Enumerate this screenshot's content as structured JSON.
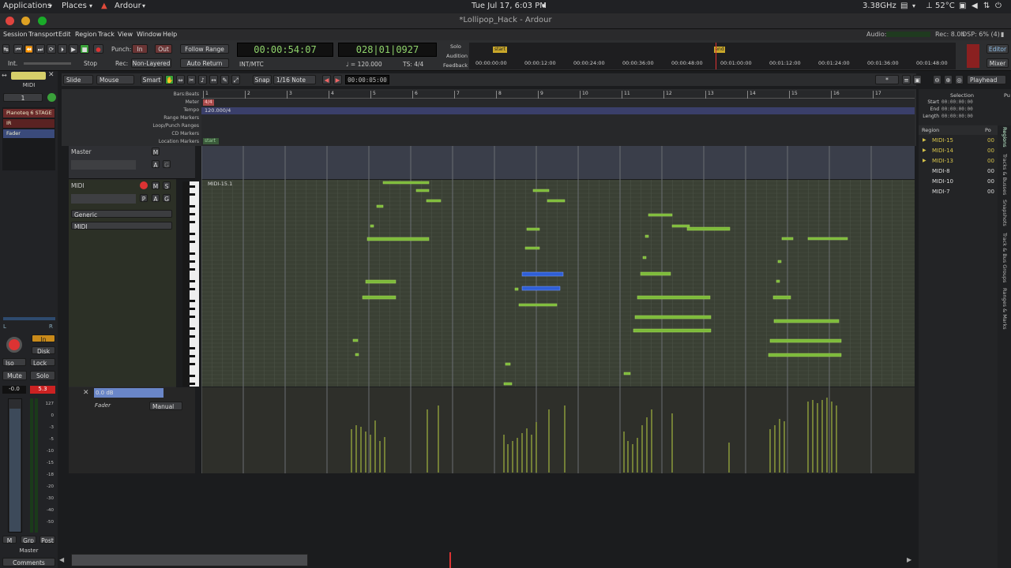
{
  "system": {
    "applications": "Applications",
    "places": "Places",
    "app": "Ardour",
    "datetime": "Tue Jul 17,  6:03 PM",
    "cpu": "3.38GHz",
    "temp": "52°C"
  },
  "window": {
    "title": "*Lollipop_Hack - Ardour"
  },
  "menu": [
    "Session",
    "Transport",
    "Edit",
    "Region",
    "Track",
    "View",
    "Window",
    "Help"
  ],
  "status": {
    "audio": "Audio:",
    "rec": "Rec: 8.0h",
    "dsp": "DSP: 6% (4)"
  },
  "transport": {
    "punch": "Punch:",
    "punch_in": "In",
    "punch_out": "Out",
    "follow_range": "Follow Range",
    "stop": "Stop",
    "rec": "Rec:",
    "non_layered": "Non-Layered",
    "auto_return": "Auto Return",
    "int": "Int.",
    "primary_clock": "00:00:54:07",
    "secondary_clock": "028|01|0927",
    "int_mtc": "INT/MTC",
    "tempo": "♩ = 120.000",
    "ts": "TS: 4/4",
    "solo": "Solo",
    "audition": "Audition",
    "feedback": "Feedback",
    "mini_start": "start",
    "mini_end": "end",
    "mini_times": [
      "00:00:00:00",
      "00:00:12:00",
      "00:00:24:00",
      "00:00:36:00",
      "00:00:48:00",
      "00:01:00:00",
      "00:01:12:00",
      "00:01:24:00",
      "00:01:36:00",
      "00:01:48:00"
    ],
    "editor": "Editor",
    "mixer": "Mixer"
  },
  "toolbar": {
    "edit_mode": "Slide",
    "cursor_mode": "Mouse",
    "smart": "Smart",
    "snap": "Snap",
    "grid": "1/16 Note",
    "nudge": "00:00:05:00",
    "zoom_focus": "Playhead",
    "star": "*"
  },
  "rulers": {
    "labels": [
      "Bars:Beats",
      "Meter",
      "Tempo",
      "Range Markers",
      "Loop/Punch Ranges",
      "CD Markers",
      "Location Markers"
    ],
    "meter_value": "4/4",
    "tempo_value": "120.000/4",
    "start_marker": "start",
    "bars": [
      "1",
      "2",
      "3",
      "4",
      "5",
      "6",
      "7",
      "8",
      "9",
      "10",
      "11",
      "12",
      "13",
      "14",
      "15",
      "16",
      "17"
    ]
  },
  "tracks": {
    "master": {
      "name": "Master",
      "m": "M",
      "a": "A",
      "g": "G"
    },
    "midi": {
      "name": "MIDI",
      "m": "M",
      "s": "S",
      "p": "P",
      "a": "A",
      "g": "G",
      "instrument": "Generic",
      "channel": "MIDI",
      "region_name": "MIDI-15.1",
      "fader_value": "0.0 dB",
      "fader_label": "Fader",
      "automation_mode": "Manual"
    }
  },
  "strip": {
    "name": "MIDI",
    "input": "1",
    "plugins": [
      "Pianoteq 6 STAGE",
      "IR",
      "Fader"
    ],
    "in": "In",
    "disk": "Disk",
    "iso": "Iso",
    "lock": "Lock",
    "mute": "Mute",
    "solo": "Solo",
    "gain": "-0.0",
    "peak": "5.3",
    "meter_scale": [
      "127",
      "0",
      "-3",
      "-5",
      "-10",
      "-15",
      "-18",
      "-20",
      "-30",
      "-40",
      "-50"
    ],
    "m": "M",
    "grp": "Grp",
    "post": "Post",
    "master": "Master",
    "comments": "Comments"
  },
  "sidebar": {
    "selection": "Selection",
    "start": "Start",
    "end": "End",
    "length": "Length",
    "start_val": "00:00:00:00",
    "end_val": "00:00:00:00",
    "length_val": "00:00:00:00",
    "region_hdr": "Region",
    "pos_hdr": "Po",
    "regions": [
      {
        "name": "MIDI-15",
        "color": "#d6c34a"
      },
      {
        "name": "MIDI-14",
        "color": "#d6c34a"
      },
      {
        "name": "MIDI-13",
        "color": "#d6c34a"
      },
      {
        "name": "MIDI-8",
        "color": "#dddddd"
      },
      {
        "name": "MIDI-10",
        "color": "#dddddd"
      },
      {
        "name": "MIDI-7",
        "color": "#dddddd"
      }
    ],
    "tabs": [
      "Regions",
      "Tracks & Busses",
      "Snapshots",
      "Track & Bus Groups",
      "Ranges & Marks"
    ]
  },
  "colors": {
    "accent": "#c9c24a",
    "note_green": "#7cba3a",
    "note_selected": "#2f5fd6",
    "record": "#d33",
    "clock": "#8fd36b"
  }
}
